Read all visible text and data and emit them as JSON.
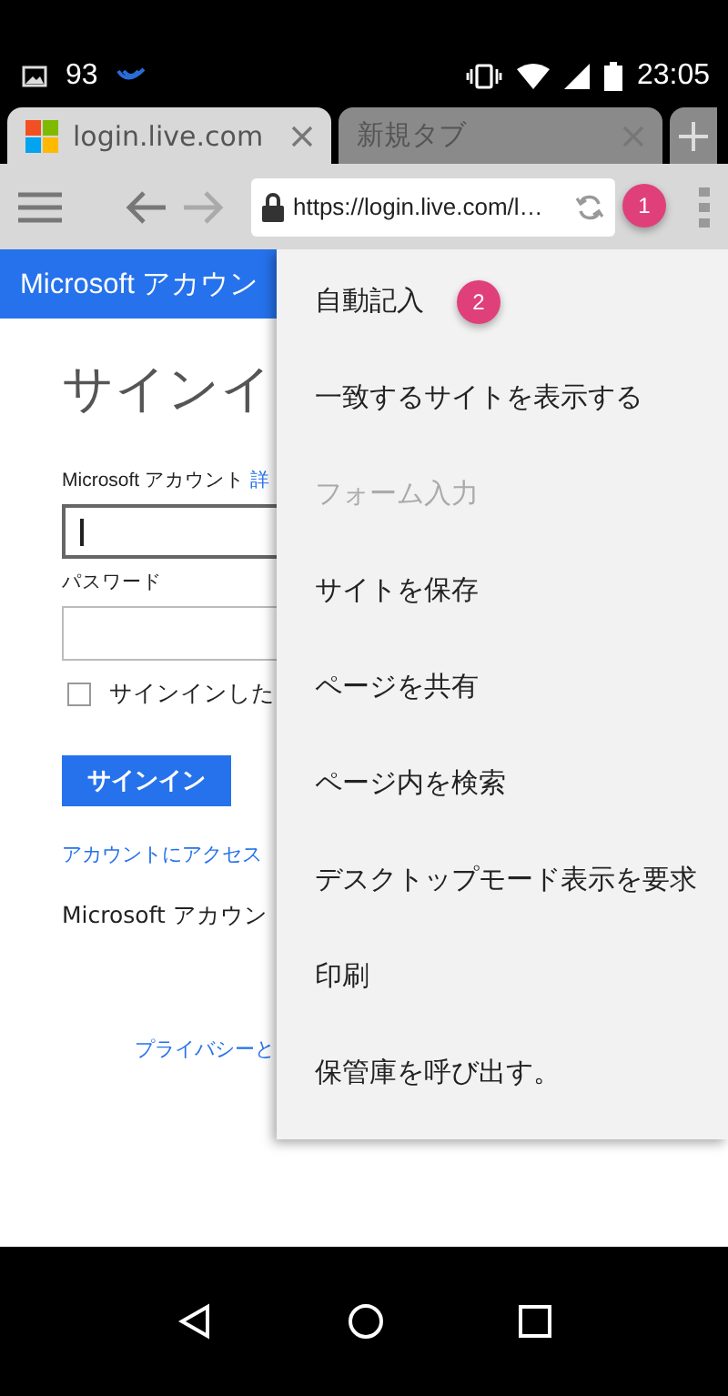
{
  "status_bar": {
    "notification_count": "93",
    "time": "23:05"
  },
  "tabs": [
    {
      "title": "login.live.com",
      "selected": true
    },
    {
      "title": "新規タブ",
      "selected": false
    }
  ],
  "toolbar": {
    "url": "https://login.live.com/l…",
    "badge": "1"
  },
  "page": {
    "header": "Microsoft アカウン",
    "heading": "サインイ",
    "account_label": "Microsoft アカウント",
    "account_link": "詳",
    "password_label": "パスワード",
    "remember": {
      "label": "サインインした",
      "checked": false
    },
    "signin_button": "サインイン",
    "access_link": "アカウントにアクセス",
    "footer_text": "Microsoft アカウン",
    "privacy_link": "プライバシーと"
  },
  "menu": {
    "items": [
      {
        "label": "自動記入",
        "disabled": false,
        "badge": "2"
      },
      {
        "label": "一致するサイトを表示する",
        "disabled": false
      },
      {
        "label": "フォーム入力",
        "disabled": true
      },
      {
        "label": "サイトを保存",
        "disabled": false
      },
      {
        "label": "ページを共有",
        "disabled": false
      },
      {
        "label": "ページ内を検索",
        "disabled": false
      },
      {
        "label": "デスクトップモード表示を要求",
        "disabled": false
      },
      {
        "label": "印刷",
        "disabled": false
      },
      {
        "label": "保管庫を呼び出す。",
        "disabled": false
      }
    ]
  }
}
